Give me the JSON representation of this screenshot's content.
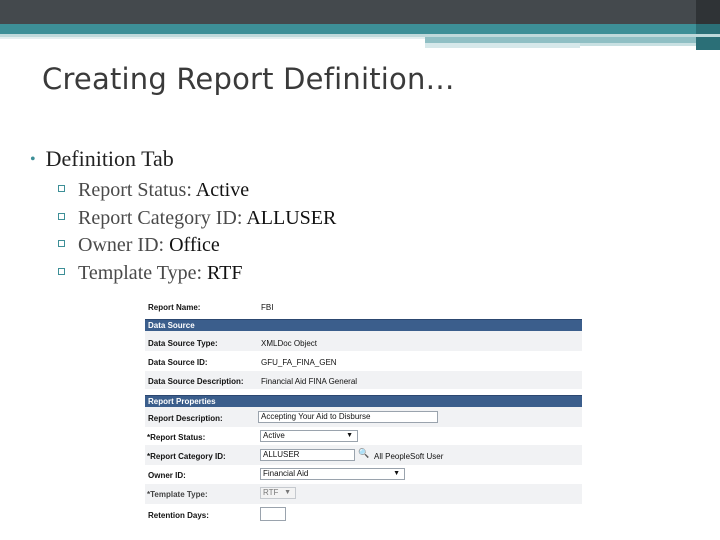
{
  "slide": {
    "title": "Creating Report Definition…",
    "bullet": "Definition Tab",
    "sub_bullets": [
      {
        "label": "Report Status: ",
        "value": "Active"
      },
      {
        "label": "Report Category ID: ",
        "value": "ALLUSER"
      },
      {
        "label": "Owner ID: ",
        "value": "Office"
      },
      {
        "label": "Template Type: ",
        "value": "RTF"
      }
    ],
    "colors": {
      "accent": "#3d8f97",
      "header_bar": "#44494d"
    }
  },
  "form": {
    "report_name_label": "Report Name:",
    "report_name_value": "FBI",
    "data_source_header": "Data Source",
    "data_source_type_label": "Data Source Type:",
    "data_source_type_value": "XMLDoc Object",
    "data_source_id_label": "Data Source ID:",
    "data_source_id_value": "GFU_FA_FINA_GEN",
    "data_source_desc_label": "Data Source Description:",
    "data_source_desc_value": "Financial Aid FINA General",
    "report_properties_header": "Report Properties",
    "report_desc_label": "Report Description:",
    "report_desc_value": "Accepting Your Aid to Disburse",
    "report_status_label": "*Report Status:",
    "report_status_value": "Active",
    "report_category_label": "*Report Category ID:",
    "report_category_value": "ALLUSER",
    "report_category_desc": "All PeopleSoft User",
    "owner_id_label": "Owner ID:",
    "owner_id_value": "Financial Aid",
    "template_type_label": "*Template Type:",
    "template_type_value": "RTF",
    "retention_days_label": "Retention Days:",
    "retention_days_value": "",
    "section_color": "#3b5e8c"
  }
}
